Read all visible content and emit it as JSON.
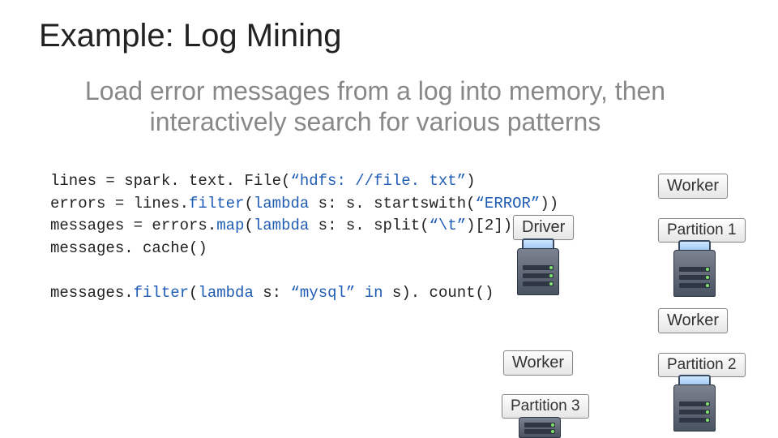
{
  "title": "Example: Log Mining",
  "subtitle": "Load error messages from a log into memory, then interactively search for various patterns",
  "code": {
    "line1_a": "lines = spark. text. File(",
    "line1_b": "“hdfs: //file. txt”",
    "line1_c": ")",
    "line2_a": "errors = lines.",
    "line2_b": "filter",
    "line2_c": "(",
    "line2_d": "lambda",
    "line2_e": " s: s. startswith(",
    "line2_f": "“ERROR”",
    "line2_g": "))",
    "line3_a": "messages = errors.",
    "line3_b": "map",
    "line3_c": "(",
    "line3_d": "lambda",
    "line3_e": " s: s. split(",
    "line3_f": "“\\t”",
    "line3_g": ")[2])",
    "line4": "messages. cache()",
    "gap": "",
    "line5_a": "messages.",
    "line5_b": "filter",
    "line5_c": "(",
    "line5_d": "lambda",
    "line5_e": " s: ",
    "line5_f": "“mysql”",
    "line5_g": " in",
    "line5_h": " s). count()"
  },
  "labels": {
    "driver": "Driver",
    "worker1": "Worker",
    "partition1": "Partition 1",
    "worker2": "Worker",
    "partition2": "Partition 2",
    "worker3": "Worker",
    "partition3": "Partition 3"
  }
}
